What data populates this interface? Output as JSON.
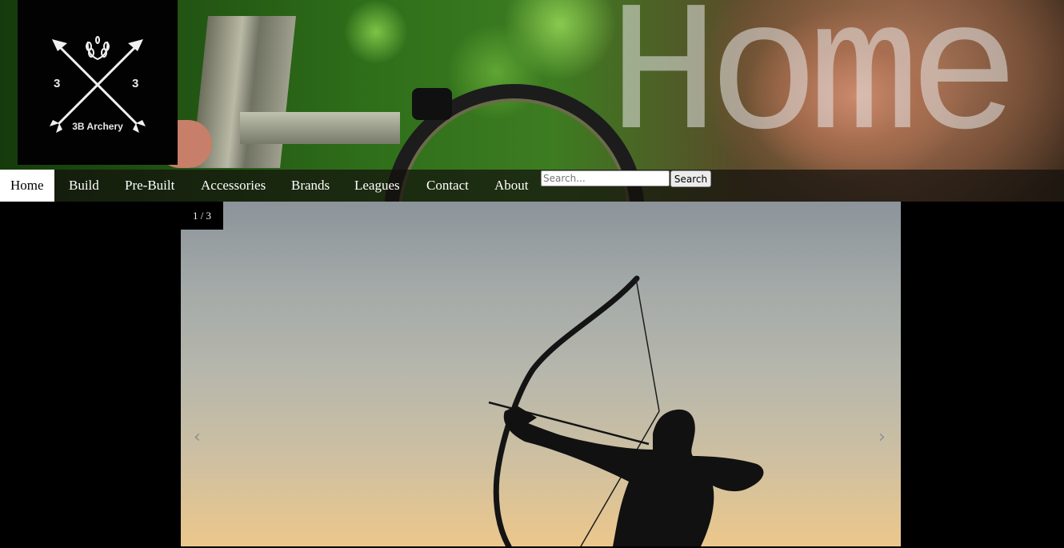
{
  "header": {
    "page_title": "Home",
    "logo": {
      "text": "3B Archery",
      "number_left": "3",
      "number_right": "3"
    }
  },
  "nav": {
    "items": [
      {
        "label": "Home",
        "active": true
      },
      {
        "label": "Build"
      },
      {
        "label": "Pre-Built"
      },
      {
        "label": "Accessories"
      },
      {
        "label": "Brands"
      },
      {
        "label": "Leagues"
      },
      {
        "label": "Contact"
      },
      {
        "label": "About"
      }
    ],
    "search": {
      "placeholder": "Search...",
      "button_label": "Search"
    }
  },
  "slideshow": {
    "counter": "1 / 3",
    "prev_icon": "‹",
    "next_icon": "›"
  },
  "colors": {
    "nav_active_bg": "#ffffff",
    "page_bg": "#000000"
  }
}
